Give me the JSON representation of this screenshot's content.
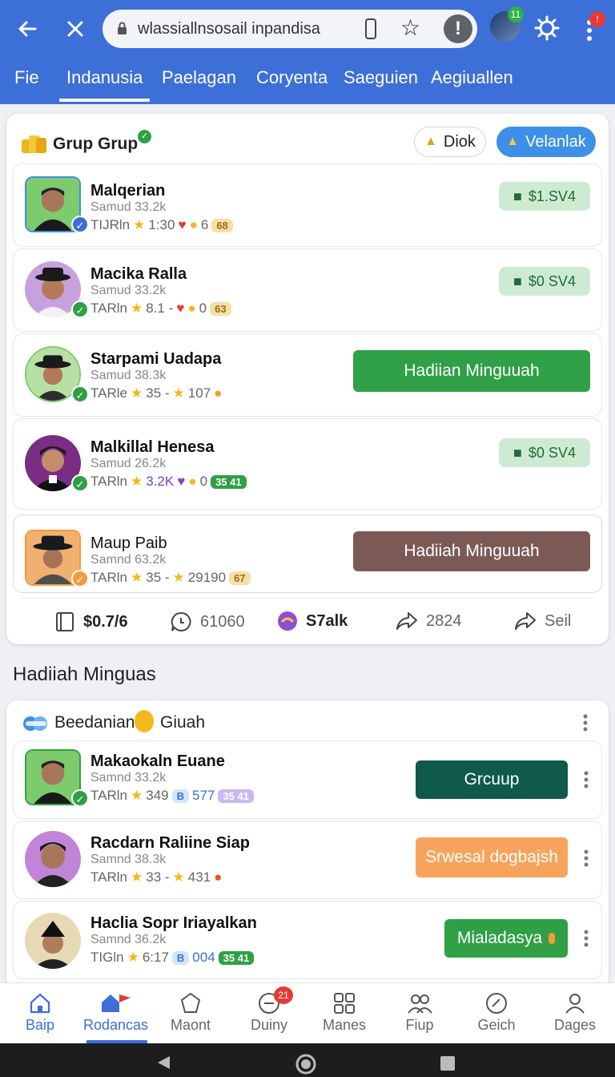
{
  "browser": {
    "url": "wlassiallnsosail inpandisa",
    "back_icon": "back-arrow-icon",
    "close_icon": "close-icon",
    "profile_badge": "11",
    "menu_badge": "!"
  },
  "tabs": [
    "Fie",
    "Indanusia",
    "Paelagan",
    "Coryenta",
    "Saeguien",
    "Aegiuallen"
  ],
  "group_card": {
    "title": "Grup Grup",
    "btn_outline": "Diok",
    "btn_primary": "Velanlak",
    "rows": [
      {
        "name": "Malqerian",
        "sub": "Samud 33.2k",
        "stat_label": "TIJRln",
        "stat1": "1:30",
        "stat_extra": "6",
        "chip": "68",
        "action_type": "pay",
        "action": "$1.SV4"
      },
      {
        "name": "Macika Ralla",
        "sub": "Samud 33.2k",
        "stat_label": "TARln",
        "stat1": "8.1 -",
        "stat_extra": "0",
        "chip": "63",
        "action_type": "pay",
        "action": "$0 SV4"
      },
      {
        "name": "Starpami Uadapa",
        "sub": "Samud 38.3k",
        "stat_label": "TARle",
        "stat1": "35 -",
        "stat_extra": "107",
        "chip": "",
        "action_type": "big",
        "action": "Hadiian Minguuah"
      },
      {
        "name": "Malkillal Henesa",
        "sub": "Samud 26.2k",
        "stat_label": "TARln",
        "stat1": "3.2K",
        "stat_extra": "0",
        "chip": "35 41",
        "action_type": "pay",
        "action": "$0 SV4"
      },
      {
        "name": "Maup Paib",
        "sub": "Samnd 63.2k",
        "stat_label": "TARln",
        "stat1": "35 -",
        "stat_extra": "29190",
        "chip": "67",
        "action_type": "big",
        "action": "Hadiiah Minguuah"
      }
    ],
    "footer": [
      {
        "label": "$0.7/6",
        "icon": "book-icon"
      },
      {
        "label": "61060",
        "icon": "chat-icon"
      },
      {
        "label": "S7alk",
        "icon": "badge-icon"
      },
      {
        "label": "2824",
        "icon": "share-icon"
      },
      {
        "label": "Seil",
        "icon": "share-icon"
      }
    ]
  },
  "section_title": "Hadiiah Minguas",
  "second_card": {
    "title": "Beedanian",
    "title2": "Giuah",
    "rows": [
      {
        "name": "Makaokaln Euane",
        "sub": "Samnd 33.2k",
        "stat_label": "TARln",
        "stat1": "349",
        "stat2": "577",
        "chip": "35 41",
        "action": "Grcuup",
        "color": "#0f5a4c"
      },
      {
        "name": "Racdarn Raliine Siap",
        "sub": "Samnd 38.3k",
        "stat_label": "TARln",
        "stat1": "33 -",
        "stat2": "431",
        "chip": "",
        "action": "Srwesal dogbajsh",
        "color": "#f7a35c"
      },
      {
        "name": "Haclia Sopr Iriayalkan",
        "sub": "Samnd 36.2k",
        "stat_label": "TIGln",
        "stat1": "6:17",
        "stat2": "004",
        "chip": "35 41",
        "action": "Mialadasya",
        "color": "#2fa046"
      }
    ]
  },
  "nav": [
    {
      "label": "Baip",
      "icon": "home-icon"
    },
    {
      "label": "Rodancas",
      "icon": "home-flag-icon"
    },
    {
      "label": "Maont",
      "icon": "pentagon-icon"
    },
    {
      "label": "Duiny",
      "icon": "chat-bubble-icon",
      "badge": "21"
    },
    {
      "label": "Manes",
      "icon": "grid-icon"
    },
    {
      "label": "Fiup",
      "icon": "people-icon"
    },
    {
      "label": "Geich",
      "icon": "check-circle-icon"
    },
    {
      "label": "Dages",
      "icon": "person-icon"
    }
  ]
}
